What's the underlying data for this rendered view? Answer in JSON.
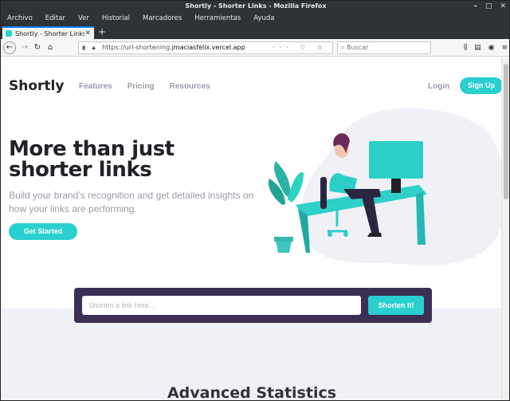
{
  "window": {
    "title": "Shortly - Shorter Links - Mozilla Firefox",
    "controls": [
      "–",
      "□",
      "✕"
    ]
  },
  "menu": [
    "Archivo",
    "Editar",
    "Ver",
    "Historial",
    "Marcadores",
    "Herramientas",
    "Ayuda"
  ],
  "tab": {
    "title": "Shortly - Shorter Links",
    "close": "✕",
    "new_tab": "+"
  },
  "nav": {
    "url_prefix": "https://url-shortening.",
    "url_domain": "jmaciasfelix.vercel.app",
    "search_placeholder": "Buscar",
    "url_actions": "··· ♡ ☆"
  },
  "site": {
    "logo": "Shortly",
    "links": [
      "Features",
      "Pricing",
      "Resources"
    ],
    "login": "Login",
    "signup": "Sign Up",
    "hero_title": "More than just shorter links",
    "hero_subtitle": "Build your brand’s recognition and get detailed insights on how your links are performing.",
    "cta": "Get Started",
    "shorten_placeholder": "Shorten a link here...",
    "shorten_button": "Shorten It!",
    "section_title": "Advanced Statistics"
  },
  "colors": {
    "accent": "#2acfcf",
    "dark_violet": "#3b3054",
    "text_dark": "#232127",
    "text_gray": "#9e9aa7"
  },
  "icons": {
    "back": "arrow-left-icon",
    "forward": "arrow-right-icon",
    "reload": "reload-icon",
    "home": "home-icon"
  }
}
